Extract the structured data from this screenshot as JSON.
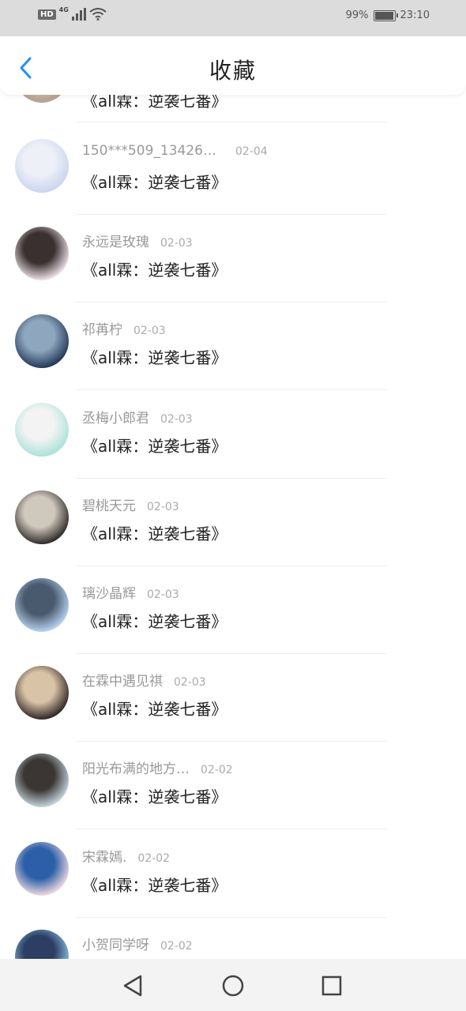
{
  "status_bar": {
    "hd": "HD",
    "network": "4G",
    "battery_percent": "99%",
    "battery_level": 0.99,
    "time": "23:10"
  },
  "header": {
    "title": "收藏",
    "back_icon": "chevron-left-icon"
  },
  "partial_top": {
    "book": "《all霖：逆袭七番》"
  },
  "items": [
    {
      "user": "150***509_1342607…",
      "date": "02-04",
      "book": "《all霖：逆袭七番》",
      "avatar_colors": [
        "#c9d4ee",
        "#eef0f8"
      ]
    },
    {
      "user": "永远是玫瑰",
      "date": "02-03",
      "book": "《all霖：逆袭七番》",
      "avatar_colors": [
        "#f4e8ee",
        "#3a3030"
      ]
    },
    {
      "user": "祁苒柠",
      "date": "02-03",
      "book": "《all霖：逆袭七番》",
      "avatar_colors": [
        "#1f3553",
        "#8fa6bf"
      ]
    },
    {
      "user": "丞梅小郎君",
      "date": "02-03",
      "book": "《all霖：逆袭七番》",
      "avatar_colors": [
        "#a9e2d8",
        "#f3f3f3"
      ]
    },
    {
      "user": "碧桃天元",
      "date": "02-03",
      "book": "《all霖：逆袭七番》",
      "avatar_colors": [
        "#2a2622",
        "#cfc8bd"
      ]
    },
    {
      "user": "璃沙晶辉",
      "date": "02-03",
      "book": "《all霖：逆袭七番》",
      "avatar_colors": [
        "#bcd8f4",
        "#4a5a6e"
      ]
    },
    {
      "user": "在霖中遇见祺",
      "date": "02-03",
      "book": "《all霖：逆袭七番》",
      "avatar_colors": [
        "#2b2220",
        "#d9c3a7"
      ]
    },
    {
      "user": "阳光布满的地方…",
      "date": "02-02",
      "book": "《all霖：逆袭七番》",
      "avatar_colors": [
        "#c8dbe3",
        "#3b3633"
      ]
    },
    {
      "user": "宋霖嫣.",
      "date": "02-02",
      "book": "《all霖：逆袭七番》",
      "avatar_colors": [
        "#f4dde2",
        "#2b5fa8"
      ]
    },
    {
      "user": "小贺同学呀",
      "date": "02-02",
      "book": "",
      "avatar_colors": [
        "#8ec7e8",
        "#2c3e63"
      ]
    }
  ],
  "nav": {
    "back_icon": "triangle-back-icon",
    "home_icon": "circle-home-icon",
    "recents_icon": "square-recents-icon"
  }
}
